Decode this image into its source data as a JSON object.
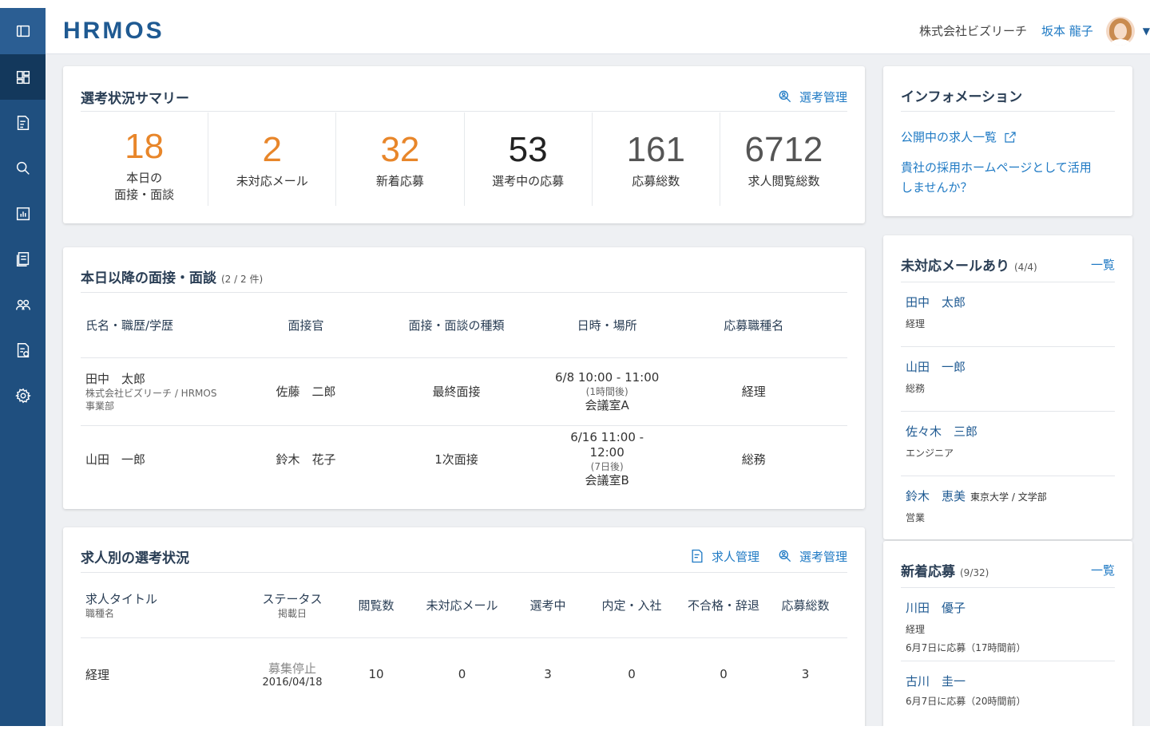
{
  "app": {
    "logo": "HRMOS"
  },
  "header": {
    "company": "株式会社ビズリーチ",
    "user": "坂本 龍子"
  },
  "sidebar": {
    "items": [
      {
        "icon": "panel-toggle-icon"
      },
      {
        "icon": "dashboard-icon"
      },
      {
        "icon": "job-list-icon"
      },
      {
        "icon": "search-icon"
      },
      {
        "icon": "bar-chart-icon"
      },
      {
        "icon": "documents-icon"
      },
      {
        "icon": "users-icon"
      },
      {
        "icon": "export-icon"
      },
      {
        "icon": "gear-icon"
      }
    ]
  },
  "summary": {
    "title": "選考状況サマリー",
    "link": "選考管理",
    "stats": [
      {
        "value": "18",
        "label_1": "本日の",
        "label_2": "面接・面談",
        "color": "#e8862a"
      },
      {
        "value": "2",
        "label_1": "未対応メール",
        "label_2": "",
        "color": "#e8862a"
      },
      {
        "value": "32",
        "label_1": "新着応募",
        "label_2": "",
        "color": "#e8862a"
      },
      {
        "value": "53",
        "label_1": "選考中の応募",
        "label_2": "",
        "color": "#222222"
      },
      {
        "value": "161",
        "label_1": "応募総数",
        "label_2": "",
        "color": "#555555"
      },
      {
        "value": "6712",
        "label_1": "求人閲覧総数",
        "label_2": "",
        "color": "#555555"
      }
    ]
  },
  "interviews": {
    "title": "本日以降の面接・面談",
    "count": "(2 / 2 件)",
    "columns": [
      "氏名・職歴/学歴",
      "面接官",
      "面接・面談の種類",
      "日時・場所",
      "応募職種名"
    ],
    "rows": [
      {
        "name": "田中　太郎",
        "career": "株式会社ビズリーチ / HRMOS",
        "dept": "事業部",
        "interviewer": "佐藤　二郎",
        "type": "最終面接",
        "time": "6/8 10:00 - 11:00",
        "relative": "(1時間後)",
        "place": "会議室A",
        "job": "経理"
      },
      {
        "name": "山田　一郎",
        "career": "",
        "dept": "",
        "interviewer": "鈴木　花子",
        "type": "1次面接",
        "time": "6/16 11:00 - 12:00",
        "relative": "(7日後)",
        "place": "会議室B",
        "job": "総務"
      }
    ]
  },
  "jobs": {
    "title": "求人別の選考状況",
    "link_jobs": "求人管理",
    "link_selection": "選考管理",
    "columns": {
      "title": "求人タイトル",
      "title_sub": "職種名",
      "status": "ステータス",
      "status_sub": "掲載日",
      "views": "閲覧数",
      "unresponded": "未対応メール",
      "in_selection": "選考中",
      "offer": "内定・入社",
      "rejected": "不合格・辞退",
      "total": "応募総数"
    },
    "rows": [
      {
        "title": "経理",
        "status": "募集停止",
        "date": "2016/04/18",
        "views": "10",
        "unresponded": "0",
        "in_selection": "3",
        "offer": "0",
        "rejected": "0",
        "total": "3"
      }
    ]
  },
  "info": {
    "title": "インフォメーション",
    "link_1": "公開中の求人一覧",
    "link_2a": "貴社の採用ホームページとして活用",
    "link_2b": "しませんか？"
  },
  "unresponded": {
    "title": "未対応メールあり",
    "count": "(4/4)",
    "more": "一覧",
    "items": [
      {
        "name": "田中　太郎",
        "school": "",
        "job": "経理"
      },
      {
        "name": "山田　一郎",
        "school": "",
        "job": "総務"
      },
      {
        "name": "佐々木　三郎",
        "school": "",
        "job": "エンジニア"
      },
      {
        "name": "鈴木　恵美",
        "school": "東京大学 / 文学部",
        "job": "営業"
      }
    ]
  },
  "newapps": {
    "title": "新着応募",
    "count": "(9/32)",
    "more": "一覧",
    "items": [
      {
        "name": "川田　優子",
        "job": "経理",
        "date": "6月7日に応募（17時間前）"
      },
      {
        "name": "古川　圭一",
        "job": "",
        "date": "6月7日に応募（20時間前）"
      }
    ]
  }
}
